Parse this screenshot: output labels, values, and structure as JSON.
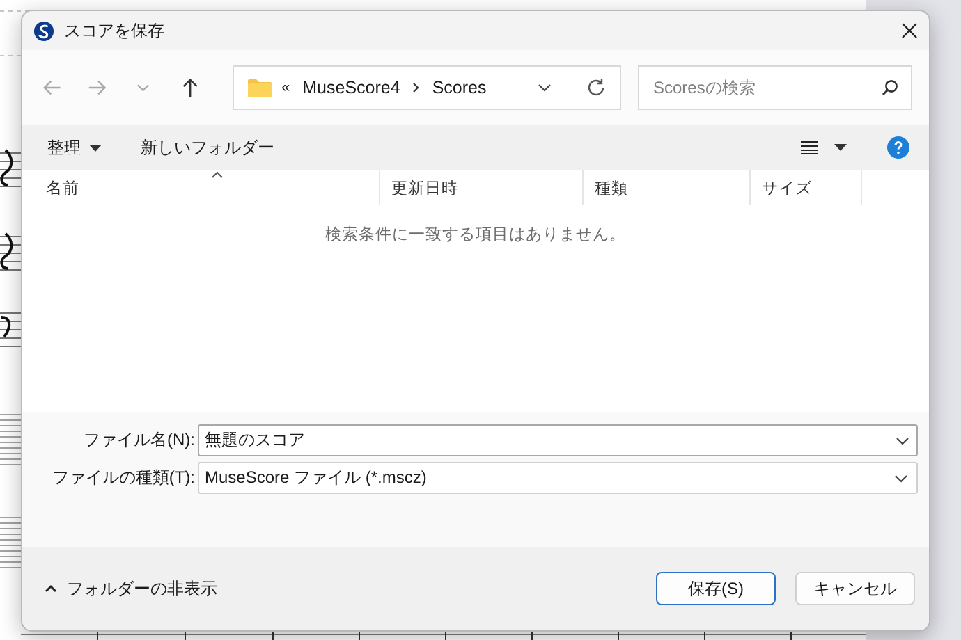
{
  "window": {
    "title": "スコアを保存"
  },
  "navigation": {
    "buttons": [
      {
        "kind": "back",
        "disabled": true
      },
      {
        "kind": "forward",
        "disabled": true
      },
      {
        "kind": "recent",
        "disabled": true
      },
      {
        "kind": "up",
        "disabled": false
      }
    ],
    "overflow": "«",
    "breadcrumb": [
      "MuseScore4",
      "Scores"
    ],
    "search": {
      "placeholder": "Scoresの検索"
    }
  },
  "toolbar": {
    "organize": "整理",
    "new_folder": "新しいフォルダー"
  },
  "file_list": {
    "columns": [
      {
        "label": "名前",
        "sorted": true
      },
      {
        "label": "更新日時",
        "sorted": false
      },
      {
        "label": "種類",
        "sorted": false
      },
      {
        "label": "サイズ",
        "sorted": false
      }
    ],
    "empty_message": "検索条件に一致する項目はありません。"
  },
  "fields": [
    {
      "label": "ファイル名(N):",
      "value": "無題のスコア"
    },
    {
      "label": "ファイルの種類(T):",
      "value": "MuseScore ファイル (*.mscz)"
    }
  ],
  "hide_folders": "フォルダーの非表示",
  "buttons": [
    {
      "label": "保存(S)",
      "default": true
    },
    {
      "label": "キャンセル",
      "default": false
    }
  ]
}
